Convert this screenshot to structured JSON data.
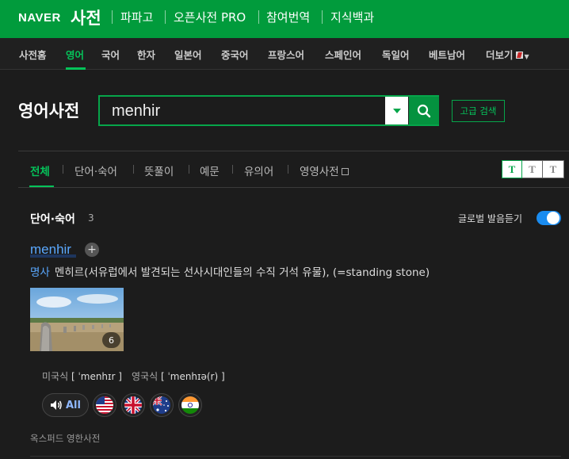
{
  "header": {
    "brand": "NAVER",
    "service": "사전",
    "links": [
      "파파고",
      "오픈사전 PRO",
      "참여번역",
      "지식백과"
    ]
  },
  "lang_nav": {
    "items": [
      "사전홈",
      "영어",
      "국어",
      "한자",
      "일본어",
      "중국어",
      "프랑스어",
      "스페인어",
      "독일어",
      "베트남어",
      "더보기"
    ],
    "active": "영어"
  },
  "search": {
    "title": "영어사전",
    "query": "menhir",
    "advanced_label": "고급 검색"
  },
  "tabs": {
    "items": [
      "전체",
      "단어·숙어",
      "뜻풀이",
      "예문",
      "유의어",
      "영영사전"
    ],
    "active": "전체"
  },
  "text_size": [
    "T",
    "T",
    "T"
  ],
  "section": {
    "title": "단어·숙어",
    "count": "3",
    "global_pron_label": "글로벌 발음듣기",
    "global_pron_on": true
  },
  "entry": {
    "word": "menhir",
    "pos": "명사",
    "definition": "멘히르(서유럽에서 발견되는 선사시대인들의 수직 거석 유물), (=standing stone)",
    "image_count": "6",
    "pron_us_label": "미국식",
    "pron_us": "[ ˈmenhɪr ]",
    "pron_uk_label": "영국식",
    "pron_uk": "[ ˈmenhɪə(r) ]",
    "audio_all_label": "All",
    "flags": [
      "us-flag-icon",
      "uk-flag-icon",
      "australia-flag-icon",
      "india-flag-icon"
    ],
    "source": "옥스퍼드 영한사전"
  },
  "colors": {
    "brand_green": "#019b3c",
    "accent_green": "#05c35a",
    "link_blue": "#5aa8ff",
    "toggle_blue": "#1a8cf0"
  }
}
